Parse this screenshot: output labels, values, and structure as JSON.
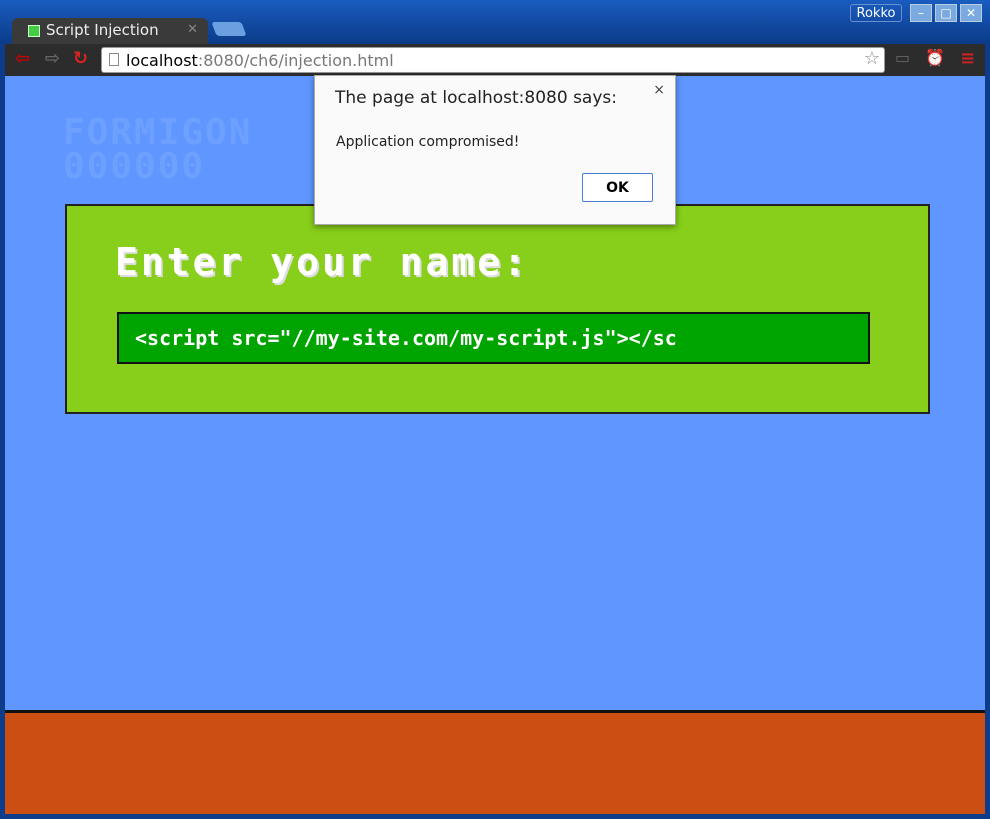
{
  "browser": {
    "tab_title": "Script Injection",
    "user": "Rokko",
    "url_host": "localhost",
    "url_rest": ":8080/ch6/injection.html"
  },
  "page": {
    "ghost_title": "FORMIGON",
    "ghost_score": "000000",
    "heading": "Enter your name:",
    "input_value": "<script src=\"//my-site.com/my-script.js\"></sc"
  },
  "dialog": {
    "title": "The page at localhost:8080 says:",
    "message": "Application compromised!",
    "ok_label": "OK",
    "close": "×"
  }
}
